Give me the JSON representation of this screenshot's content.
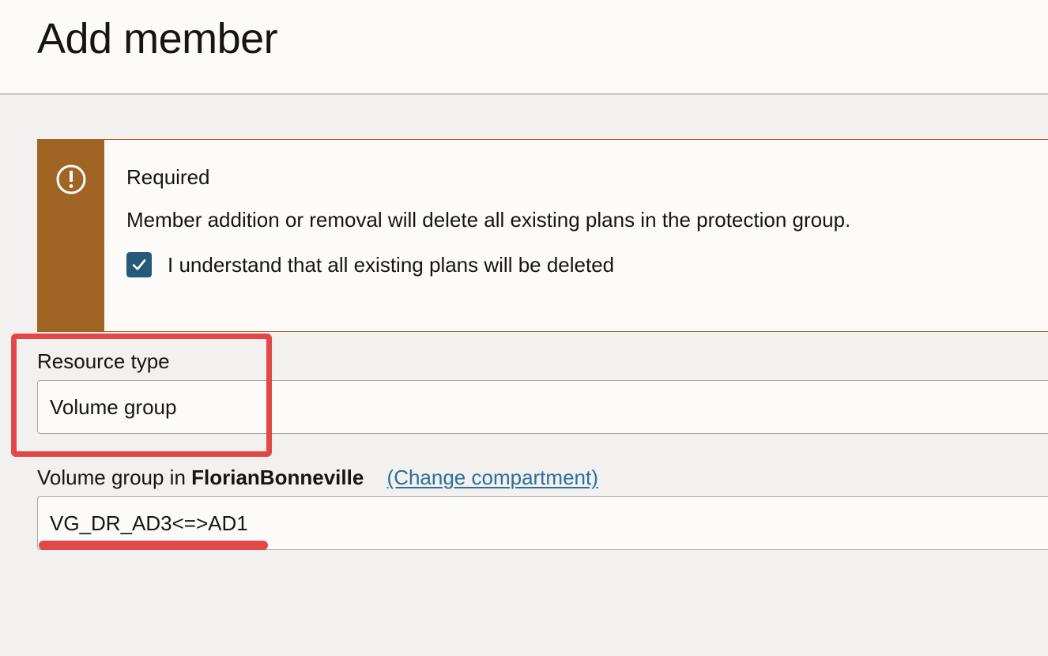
{
  "page": {
    "title": "Add member"
  },
  "warning": {
    "heading": "Required",
    "message": "Member addition or removal will delete all existing plans in the protection group.",
    "checkbox_label": "I understand that all existing plans will be deleted",
    "checkbox_checked": true,
    "icon": "exclamation-circle-icon",
    "accent_color": "#a06425"
  },
  "resource_type": {
    "label": "Resource type",
    "value": "Volume group"
  },
  "volume_group": {
    "label_prefix": "Volume group in",
    "compartment": "FlorianBonneville",
    "change_link": "(Change compartment)",
    "value": "VG_DR_AD3<=>AD1"
  },
  "annotations": {
    "color": "#e24848"
  }
}
